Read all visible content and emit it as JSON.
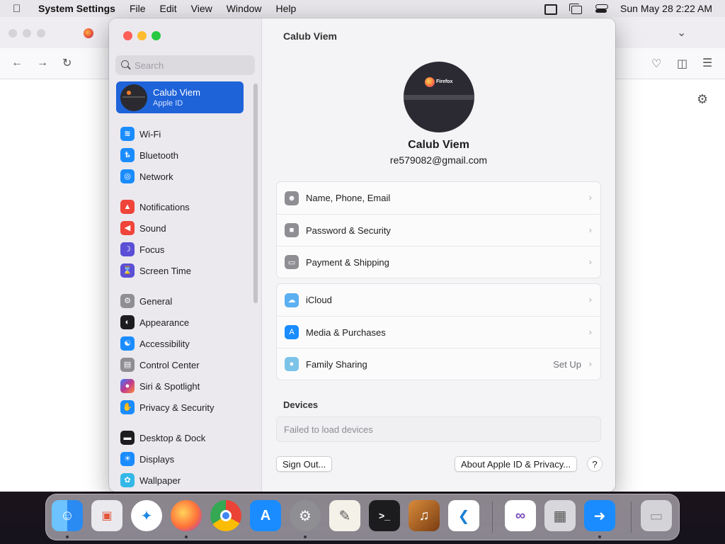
{
  "menubar": {
    "app_name": "System Settings",
    "menus": [
      "File",
      "Edit",
      "View",
      "Window",
      "Help"
    ],
    "clock": "Sun May 28  2:22 AM"
  },
  "sidebar": {
    "search_placeholder": "Search",
    "profile": {
      "name": "Calub Viem",
      "subtitle": "Apple ID"
    },
    "items": [
      {
        "label": "Wi-Fi",
        "icon": "wifi-icon",
        "color": "#1a8cff"
      },
      {
        "label": "Bluetooth",
        "icon": "bluetooth-icon",
        "color": "#1a8cff"
      },
      {
        "label": "Network",
        "icon": "globe-icon",
        "color": "#1a8cff"
      },
      {
        "label": "Notifications",
        "icon": "bell-icon",
        "color": "#f0453a"
      },
      {
        "label": "Sound",
        "icon": "speaker-icon",
        "color": "#f0453a"
      },
      {
        "label": "Focus",
        "icon": "moon-icon",
        "color": "#5b4fd6"
      },
      {
        "label": "Screen Time",
        "icon": "hourglass-icon",
        "color": "#5b4fd6"
      },
      {
        "label": "General",
        "icon": "gear-icon",
        "color": "#8e8e93"
      },
      {
        "label": "Appearance",
        "icon": "appearance-icon",
        "color": "#1d1d1f"
      },
      {
        "label": "Accessibility",
        "icon": "accessibility-icon",
        "color": "#1a8cff"
      },
      {
        "label": "Control Center",
        "icon": "control-center-icon",
        "color": "#8e8e93"
      },
      {
        "label": "Siri & Spotlight",
        "icon": "siri-icon",
        "color": "#c0398e"
      },
      {
        "label": "Privacy & Security",
        "icon": "hand-icon",
        "color": "#1a8cff"
      },
      {
        "label": "Desktop & Dock",
        "icon": "dock-icon",
        "color": "#1d1d1f"
      },
      {
        "label": "Displays",
        "icon": "sun-icon",
        "color": "#1a8cff"
      },
      {
        "label": "Wallpaper",
        "icon": "wallpaper-icon",
        "color": "#34b8e8"
      }
    ]
  },
  "main": {
    "title": "Calub Viem",
    "avatar_text": "Firefox",
    "user_name": "Calub Viem",
    "user_email": "re579082@gmail.com",
    "group1": [
      {
        "label": "Name, Phone, Email",
        "icon": "person-icon",
        "color": "#8e8e93"
      },
      {
        "label": "Password & Security",
        "icon": "lock-icon",
        "color": "#8e8e93"
      },
      {
        "label": "Payment & Shipping",
        "icon": "card-icon",
        "color": "#8e8e93"
      }
    ],
    "group2": [
      {
        "label": "iCloud",
        "icon": "cloud-icon",
        "color": "#5ab0f0",
        "value": ""
      },
      {
        "label": "Media & Purchases",
        "icon": "appstore-icon",
        "color": "#1a8cff",
        "value": ""
      },
      {
        "label": "Family Sharing",
        "icon": "family-icon",
        "color": "#7cc3e8",
        "value": "Set Up"
      }
    ],
    "devices_title": "Devices",
    "devices_status": "Failed to load devices",
    "sign_out_label": "Sign Out...",
    "about_label": "About Apple ID & Privacy...",
    "help_label": "?"
  },
  "dock": {
    "apps": [
      {
        "name": "Finder",
        "icon": "finder-icon",
        "color": "#2a8bf2"
      },
      {
        "name": "Launchpad",
        "icon": "launchpad-icon",
        "color": "#e9e9ee"
      },
      {
        "name": "Safari",
        "icon": "safari-icon",
        "color": "#1e88e5"
      },
      {
        "name": "Firefox",
        "icon": "firefox-icon",
        "color": "#ff7139"
      },
      {
        "name": "Chrome",
        "icon": "chrome-icon",
        "color": "#34a853"
      },
      {
        "name": "App Store",
        "icon": "appstore-icon",
        "color": "#1a8cff"
      },
      {
        "name": "System Settings",
        "icon": "settings-icon",
        "color": "#8e8e93"
      },
      {
        "name": "TextEdit",
        "icon": "textedit-icon",
        "color": "#f4f1e8"
      },
      {
        "name": "Terminal",
        "icon": "terminal-icon",
        "color": "#1c1c1e"
      },
      {
        "name": "Instruments",
        "icon": "instruments-icon",
        "color": "#b5651d"
      },
      {
        "name": "Visual Studio Code",
        "icon": "vscode-icon",
        "color": "#ffffff"
      },
      {
        "name": "Visual Studio",
        "icon": "visualstudio-icon",
        "color": "#ffffff"
      },
      {
        "name": "Boot Camp",
        "icon": "bootcamp-icon",
        "color": "#d8d8dc"
      },
      {
        "name": "Migration",
        "icon": "migration-icon",
        "color": "#1a8cff"
      },
      {
        "name": "Trash",
        "icon": "trash-icon",
        "color": "#e6e6ea"
      }
    ]
  }
}
